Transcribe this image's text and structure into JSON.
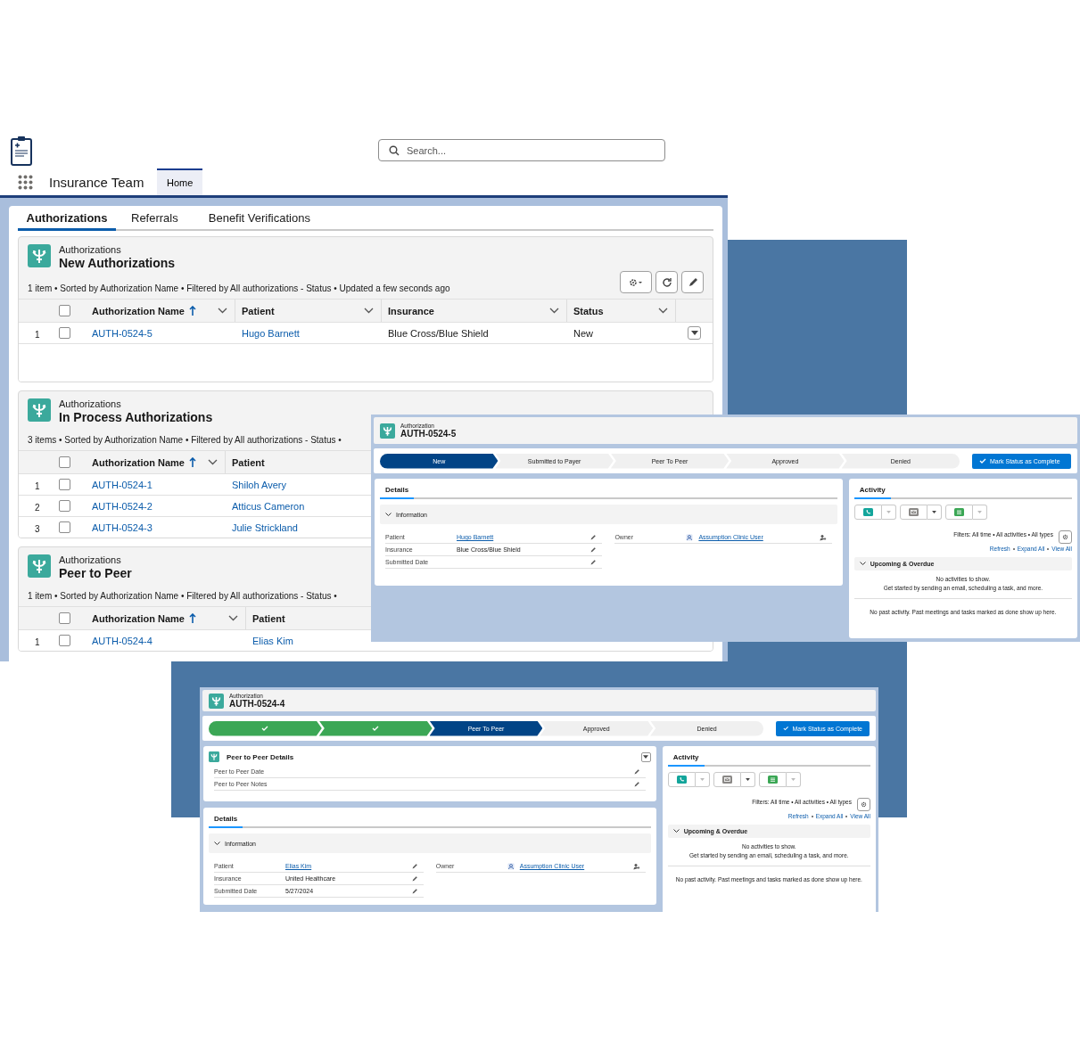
{
  "header": {
    "search": {
      "placeholder": "Search..."
    },
    "app_name": "Insurance Team",
    "nav_tabs": [
      {
        "label": "Home",
        "selected": true
      }
    ]
  },
  "list_page": {
    "tabs": [
      {
        "label": "Authorizations",
        "selected": true
      },
      {
        "label": "Referrals",
        "selected": false
      },
      {
        "label": "Benefit Verifications",
        "selected": false
      }
    ],
    "list_views": [
      {
        "object": "Authorizations",
        "title": "New Authorizations",
        "all_checked": false,
        "summary": "1 item • Sorted by Authorization Name • Filtered by All authorizations - Status • Updated a few seconds ago",
        "actions_visible": true,
        "columns": [
          {
            "label": "Authorization Name",
            "sorted": true,
            "link": true
          },
          {
            "label": "Patient",
            "sorted": false,
            "link": true
          },
          {
            "label": "Insurance",
            "sorted": false,
            "link": false
          },
          {
            "label": "Status",
            "sorted": false,
            "link": false
          }
        ],
        "rows": [
          {
            "number": "1",
            "checked": false,
            "cells": [
              "AUTH-0524-5",
              "Hugo Barnett",
              "Blue Cross/Blue Shield",
              "New"
            ]
          }
        ]
      },
      {
        "object": "Authorizations",
        "title": "In Process Authorizations",
        "all_checked": false,
        "summary": "3 items • Sorted by Authorization Name • Filtered by All authorizations - Status •",
        "actions_visible": false,
        "columns": [
          {
            "label": "Authorization Name",
            "sorted": true,
            "link": true
          },
          {
            "label": "Patient",
            "sorted": false,
            "link": true
          }
        ],
        "rows": [
          {
            "number": "1",
            "checked": false,
            "cells": [
              "AUTH-0524-1",
              "Shiloh Avery"
            ]
          },
          {
            "number": "2",
            "checked": false,
            "cells": [
              "AUTH-0524-2",
              "Atticus Cameron"
            ]
          },
          {
            "number": "3",
            "checked": false,
            "cells": [
              "AUTH-0524-3",
              "Julie Strickland"
            ]
          }
        ]
      },
      {
        "object": "Authorizations",
        "title": "Peer to Peer",
        "all_checked": false,
        "summary": "1 item • Sorted by Authorization Name • Filtered by All authorizations - Status •",
        "actions_visible": false,
        "columns": [
          {
            "label": "Authorization Name",
            "sorted": true,
            "link": true
          },
          {
            "label": "Patient",
            "sorted": false,
            "link": true
          }
        ],
        "rows": [
          {
            "number": "1",
            "checked": false,
            "cells": [
              "AUTH-0524-4",
              "Elias Kim"
            ]
          }
        ]
      }
    ]
  },
  "record_pages": [
    {
      "object": "Authorization",
      "title": "AUTH-0524-5",
      "stages": [
        {
          "label": "New",
          "current": true,
          "complete": false
        },
        {
          "label": "Submitted to Payer",
          "current": false,
          "complete": false
        },
        {
          "label": "Peer To Peer",
          "current": false,
          "complete": false
        },
        {
          "label": "Approved",
          "current": false,
          "complete": false
        },
        {
          "label": "Denied",
          "current": false,
          "complete": false
        }
      ],
      "complete_button": "Mark Status as Complete",
      "details": {
        "tab": "Details",
        "section": "Information",
        "left_fields": [
          {
            "label": "Patient",
            "value": "Hugo Barnett",
            "kind": "link"
          },
          {
            "label": "Insurance",
            "value": "Blue Cross/Blue Shield",
            "kind": "text"
          },
          {
            "label": "Submitted Date",
            "kind": "text"
          }
        ],
        "right_fields": [
          {
            "label": "Owner",
            "value": "Assumption Clinic User",
            "kind": "user"
          }
        ]
      },
      "activity": {
        "tab": "Activity",
        "filters": "Filters: All time • All activities • All types",
        "links": [
          "Refresh",
          "Expand All",
          "View All"
        ],
        "section": "Upcoming & Overdue",
        "empty_title": "No activities to show.",
        "empty_hint": "Get started by sending an email, scheduling a task, and more.",
        "past_note": "No past activity. Past meetings and tasks marked as done show up here."
      }
    },
    {
      "object": "Authorization",
      "title": "AUTH-0524-4",
      "stages": [
        {
          "current": false,
          "complete": true
        },
        {
          "current": false,
          "complete": true
        },
        {
          "label": "Peer To Peer",
          "current": true,
          "complete": false
        },
        {
          "label": "Approved",
          "current": false,
          "complete": false
        },
        {
          "label": "Denied",
          "current": false,
          "complete": false
        }
      ],
      "complete_button": "Mark Status as Complete",
      "related_card": {
        "title": "Peer to Peer Details",
        "fields": [
          {
            "label": "Peer to Peer Date"
          },
          {
            "label": "Peer to Peer Notes"
          }
        ]
      },
      "details": {
        "tab": "Details",
        "section": "Information",
        "left_fields": [
          {
            "label": "Patient",
            "value": "Elias Kim",
            "kind": "link"
          },
          {
            "label": "Insurance",
            "value": "United Healthcare",
            "kind": "text"
          },
          {
            "label": "Submitted Date",
            "value": "5/27/2024",
            "kind": "text"
          }
        ],
        "right_fields": [
          {
            "label": "Owner",
            "value": "Assumption Clinic User",
            "kind": "user"
          }
        ]
      },
      "activity": {
        "tab": "Activity",
        "filters": "Filters: All time • All activities • All types",
        "links": [
          "Refresh",
          "Expand All",
          "View All"
        ],
        "section": "Upcoming & Overdue",
        "empty_title": "No activities to show.",
        "empty_hint": "Get started by sending an email, scheduling a task, and more.",
        "past_note": "No past activity. Past meetings and tasks marked as done show up here."
      }
    }
  ]
}
